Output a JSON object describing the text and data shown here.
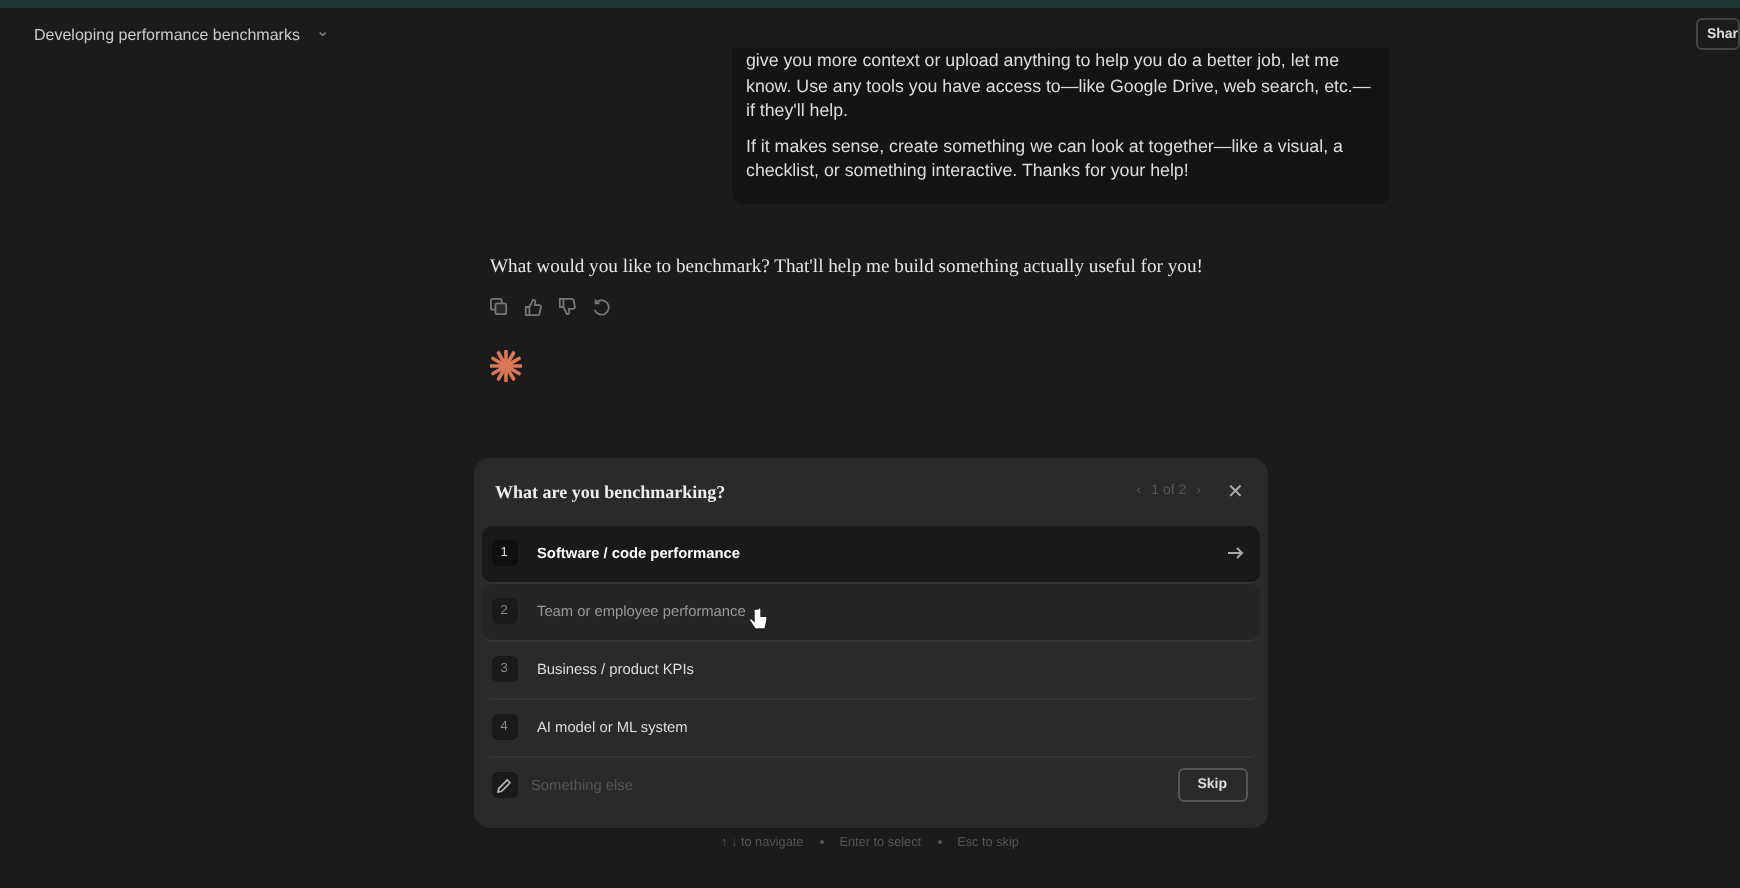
{
  "header": {
    "title": "Developing performance benchmarks",
    "chevron": "⌄",
    "share_button": "Shar"
  },
  "user_message": {
    "paragraphs": [
      "give you more context or upload anything to help you do a better job, let me know. Use any tools you have access to—like Google Drive, web search, etc.—if they'll help.",
      "If it makes sense, create something we can look at together—like a visual, a checklist, or something interactive. Thanks for your help!"
    ]
  },
  "assistant_message": {
    "text": "What would you like to benchmark? That'll help me build something actually useful for you!"
  },
  "question_panel": {
    "title": "What are you benchmarking?",
    "pager": "1 of 2",
    "prev": "‹",
    "next": "›",
    "close": "✕",
    "options": [
      {
        "number": "1",
        "label": "Software / code performance",
        "selected": true,
        "hovered": false
      },
      {
        "number": "2",
        "label": "Team or employee performance",
        "selected": false,
        "hovered": true
      },
      {
        "number": "3",
        "label": "Business / product KPIs",
        "selected": false,
        "hovered": false
      },
      {
        "number": "4",
        "label": "AI model or ML system",
        "selected": false,
        "hovered": false
      }
    ],
    "other_placeholder": "Something else",
    "skip_button": "Skip"
  },
  "hints": [
    "↑ ↓ to navigate",
    "Enter to select",
    "Esc to skip"
  ]
}
